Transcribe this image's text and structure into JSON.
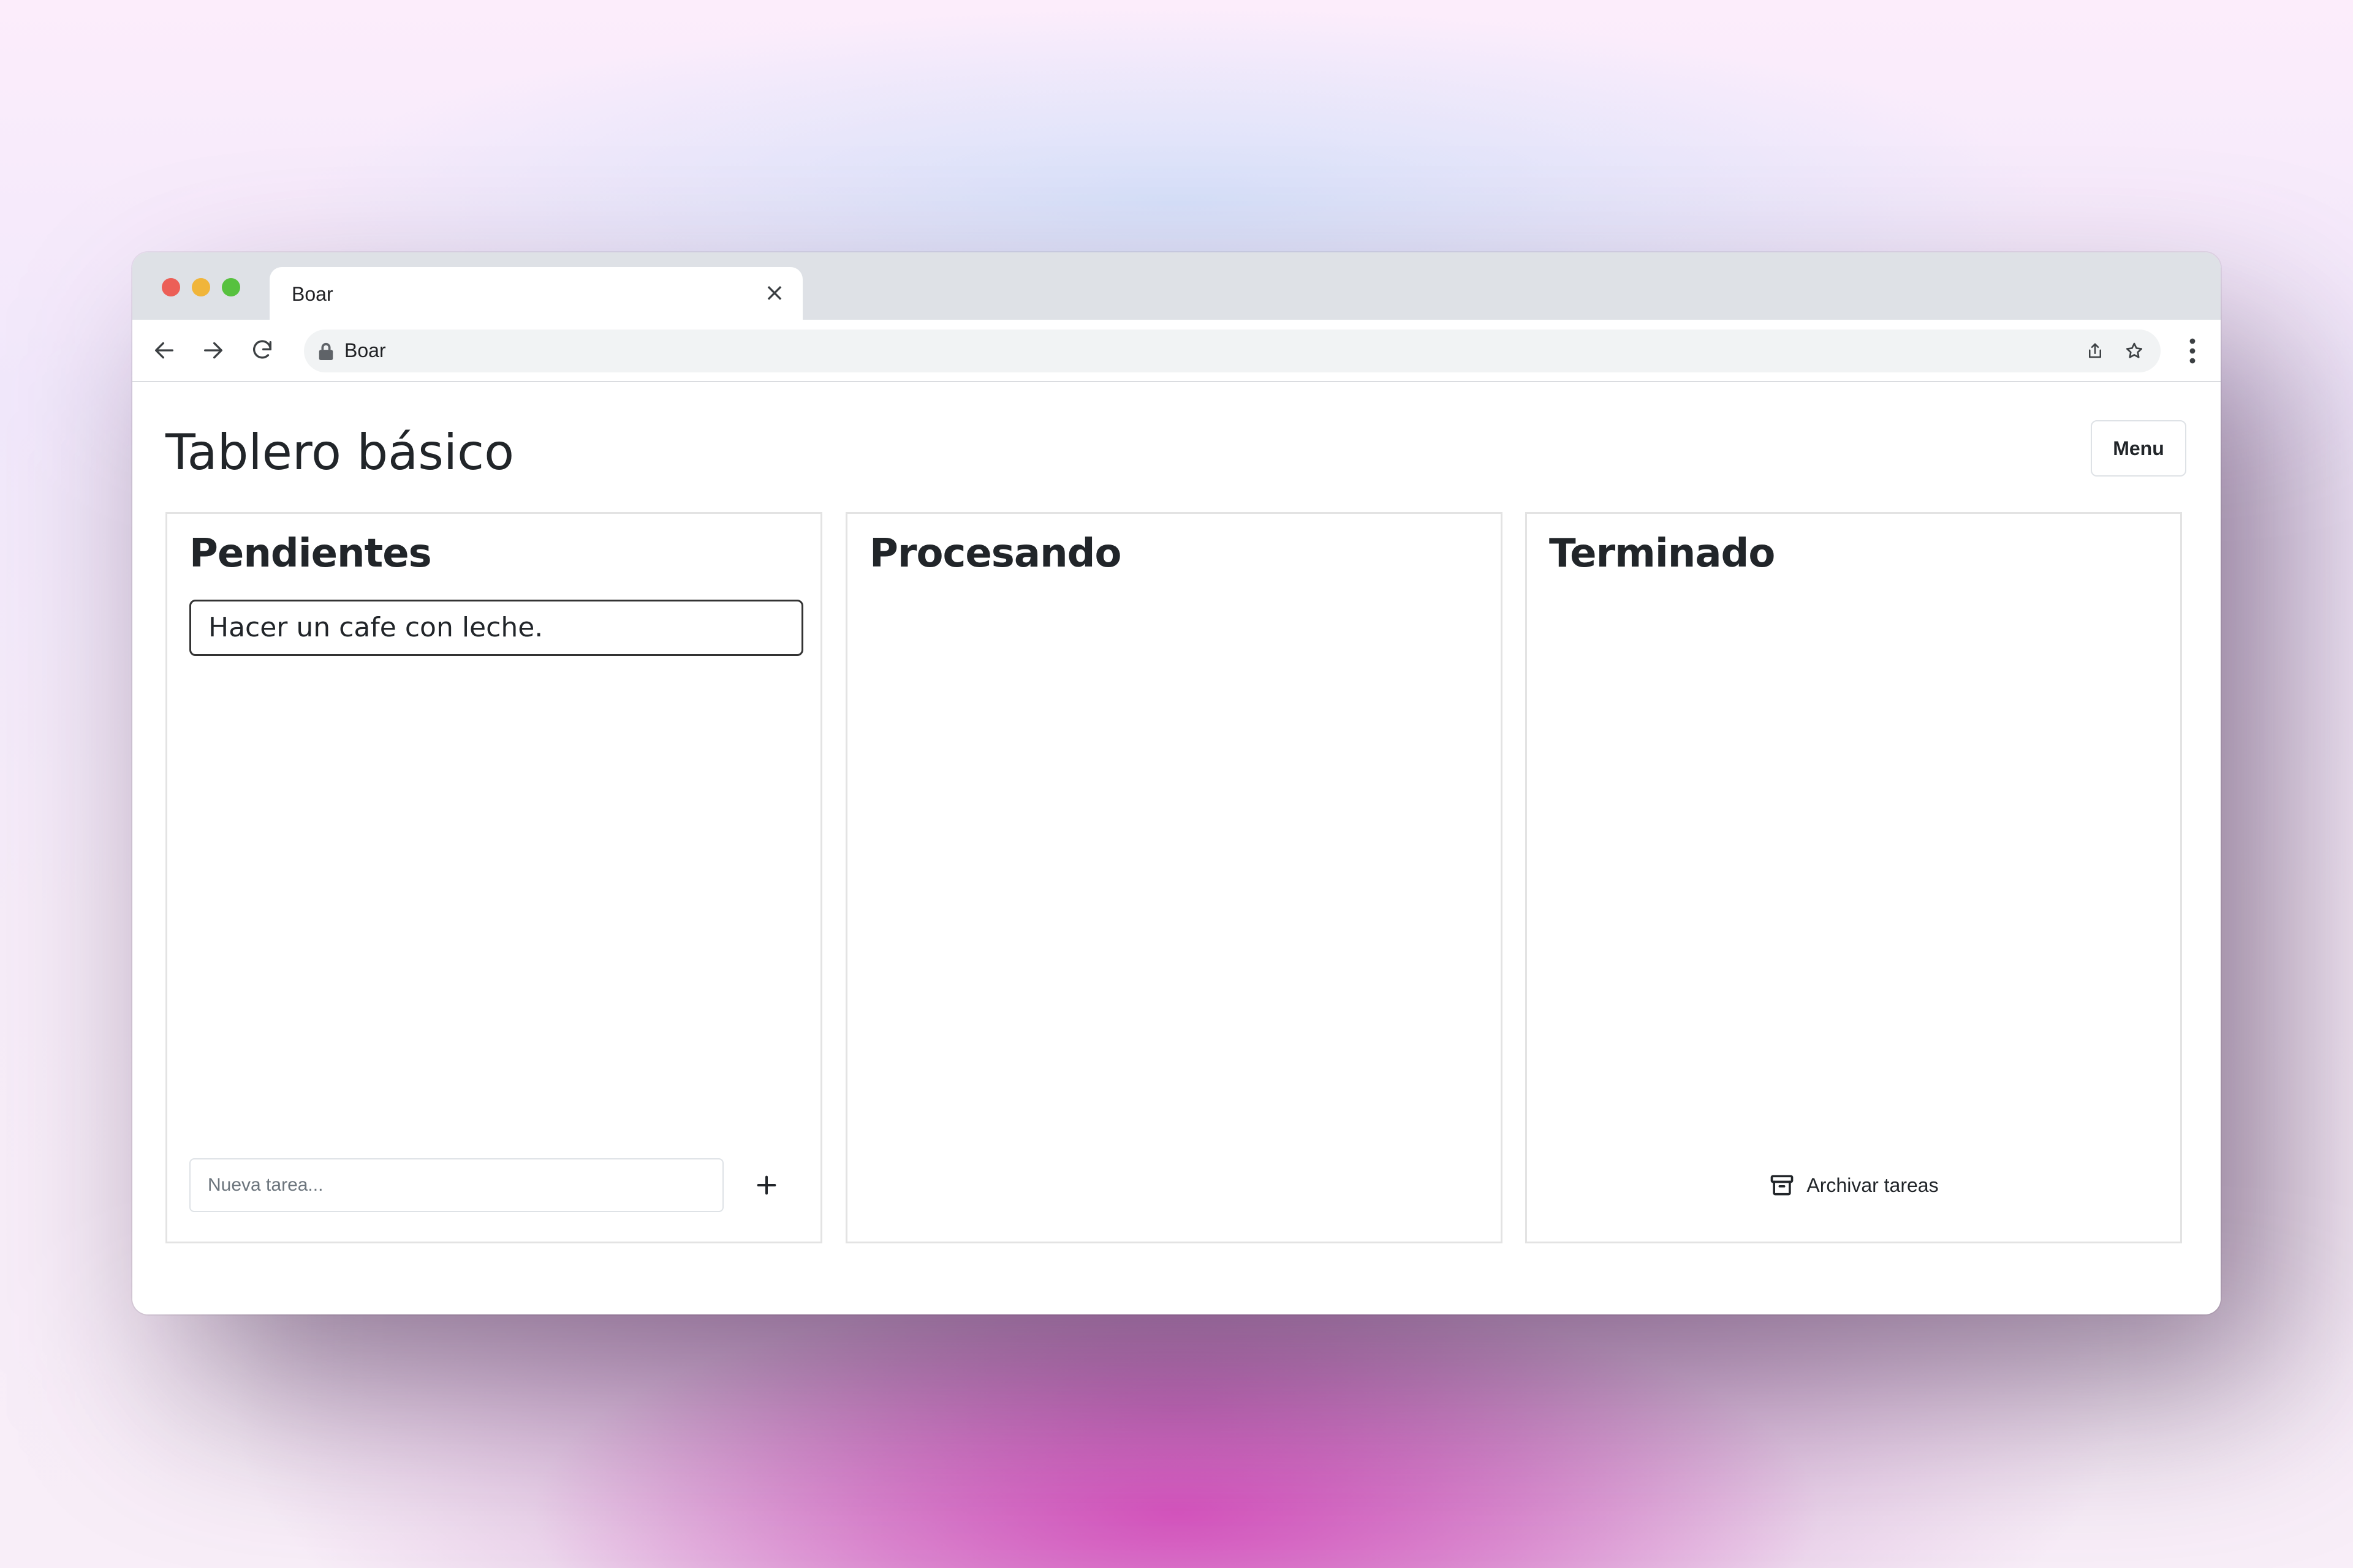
{
  "browser": {
    "tab_title": "Boar",
    "address": "Boar",
    "icons": {
      "back": "arrow-left-icon",
      "forward": "arrow-right-icon",
      "reload": "reload-icon",
      "lock": "lock-icon",
      "share": "share-icon",
      "bookmark": "star-icon",
      "menu": "kebab-menu-icon",
      "close_tab": "close-icon"
    },
    "window_controls": {
      "close_color": "#ec5f57",
      "minimize_color": "#f0b53a",
      "maximize_color": "#57c13f"
    }
  },
  "page": {
    "title": "Tablero básico",
    "menu_label": "Menu"
  },
  "columns": [
    {
      "title": "Pendientes",
      "tasks": [
        "Hacer un cafe con leche."
      ],
      "new_task_placeholder": "Nueva tarea...",
      "new_task_value": "",
      "add_icon": "plus-icon"
    },
    {
      "title": "Procesando",
      "tasks": []
    },
    {
      "title": "Terminado",
      "tasks": [],
      "archive_label": "Archivar tareas",
      "archive_icon": "archive-box-icon"
    }
  ]
}
